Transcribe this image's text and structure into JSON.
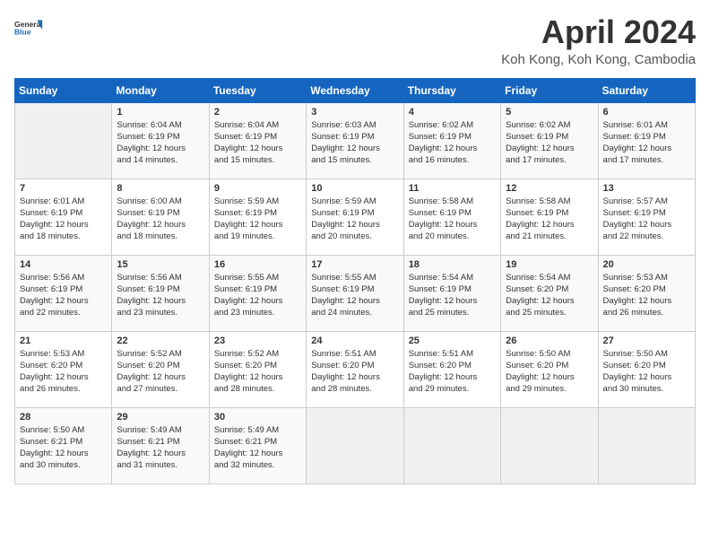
{
  "header": {
    "logo_line1": "General",
    "logo_line2": "Blue",
    "month": "April 2024",
    "location": "Koh Kong, Koh Kong, Cambodia"
  },
  "weekdays": [
    "Sunday",
    "Monday",
    "Tuesday",
    "Wednesday",
    "Thursday",
    "Friday",
    "Saturday"
  ],
  "weeks": [
    [
      {
        "day": "",
        "info": ""
      },
      {
        "day": "1",
        "info": "Sunrise: 6:04 AM\nSunset: 6:19 PM\nDaylight: 12 hours\nand 14 minutes."
      },
      {
        "day": "2",
        "info": "Sunrise: 6:04 AM\nSunset: 6:19 PM\nDaylight: 12 hours\nand 15 minutes."
      },
      {
        "day": "3",
        "info": "Sunrise: 6:03 AM\nSunset: 6:19 PM\nDaylight: 12 hours\nand 15 minutes."
      },
      {
        "day": "4",
        "info": "Sunrise: 6:02 AM\nSunset: 6:19 PM\nDaylight: 12 hours\nand 16 minutes."
      },
      {
        "day": "5",
        "info": "Sunrise: 6:02 AM\nSunset: 6:19 PM\nDaylight: 12 hours\nand 17 minutes."
      },
      {
        "day": "6",
        "info": "Sunrise: 6:01 AM\nSunset: 6:19 PM\nDaylight: 12 hours\nand 17 minutes."
      }
    ],
    [
      {
        "day": "7",
        "info": "Sunrise: 6:01 AM\nSunset: 6:19 PM\nDaylight: 12 hours\nand 18 minutes."
      },
      {
        "day": "8",
        "info": "Sunrise: 6:00 AM\nSunset: 6:19 PM\nDaylight: 12 hours\nand 18 minutes."
      },
      {
        "day": "9",
        "info": "Sunrise: 5:59 AM\nSunset: 6:19 PM\nDaylight: 12 hours\nand 19 minutes."
      },
      {
        "day": "10",
        "info": "Sunrise: 5:59 AM\nSunset: 6:19 PM\nDaylight: 12 hours\nand 20 minutes."
      },
      {
        "day": "11",
        "info": "Sunrise: 5:58 AM\nSunset: 6:19 PM\nDaylight: 12 hours\nand 20 minutes."
      },
      {
        "day": "12",
        "info": "Sunrise: 5:58 AM\nSunset: 6:19 PM\nDaylight: 12 hours\nand 21 minutes."
      },
      {
        "day": "13",
        "info": "Sunrise: 5:57 AM\nSunset: 6:19 PM\nDaylight: 12 hours\nand 22 minutes."
      }
    ],
    [
      {
        "day": "14",
        "info": "Sunrise: 5:56 AM\nSunset: 6:19 PM\nDaylight: 12 hours\nand 22 minutes."
      },
      {
        "day": "15",
        "info": "Sunrise: 5:56 AM\nSunset: 6:19 PM\nDaylight: 12 hours\nand 23 minutes."
      },
      {
        "day": "16",
        "info": "Sunrise: 5:55 AM\nSunset: 6:19 PM\nDaylight: 12 hours\nand 23 minutes."
      },
      {
        "day": "17",
        "info": "Sunrise: 5:55 AM\nSunset: 6:19 PM\nDaylight: 12 hours\nand 24 minutes."
      },
      {
        "day": "18",
        "info": "Sunrise: 5:54 AM\nSunset: 6:19 PM\nDaylight: 12 hours\nand 25 minutes."
      },
      {
        "day": "19",
        "info": "Sunrise: 5:54 AM\nSunset: 6:20 PM\nDaylight: 12 hours\nand 25 minutes."
      },
      {
        "day": "20",
        "info": "Sunrise: 5:53 AM\nSunset: 6:20 PM\nDaylight: 12 hours\nand 26 minutes."
      }
    ],
    [
      {
        "day": "21",
        "info": "Sunrise: 5:53 AM\nSunset: 6:20 PM\nDaylight: 12 hours\nand 26 minutes."
      },
      {
        "day": "22",
        "info": "Sunrise: 5:52 AM\nSunset: 6:20 PM\nDaylight: 12 hours\nand 27 minutes."
      },
      {
        "day": "23",
        "info": "Sunrise: 5:52 AM\nSunset: 6:20 PM\nDaylight: 12 hours\nand 28 minutes."
      },
      {
        "day": "24",
        "info": "Sunrise: 5:51 AM\nSunset: 6:20 PM\nDaylight: 12 hours\nand 28 minutes."
      },
      {
        "day": "25",
        "info": "Sunrise: 5:51 AM\nSunset: 6:20 PM\nDaylight: 12 hours\nand 29 minutes."
      },
      {
        "day": "26",
        "info": "Sunrise: 5:50 AM\nSunset: 6:20 PM\nDaylight: 12 hours\nand 29 minutes."
      },
      {
        "day": "27",
        "info": "Sunrise: 5:50 AM\nSunset: 6:20 PM\nDaylight: 12 hours\nand 30 minutes."
      }
    ],
    [
      {
        "day": "28",
        "info": "Sunrise: 5:50 AM\nSunset: 6:21 PM\nDaylight: 12 hours\nand 30 minutes."
      },
      {
        "day": "29",
        "info": "Sunrise: 5:49 AM\nSunset: 6:21 PM\nDaylight: 12 hours\nand 31 minutes."
      },
      {
        "day": "30",
        "info": "Sunrise: 5:49 AM\nSunset: 6:21 PM\nDaylight: 12 hours\nand 32 minutes."
      },
      {
        "day": "",
        "info": ""
      },
      {
        "day": "",
        "info": ""
      },
      {
        "day": "",
        "info": ""
      },
      {
        "day": "",
        "info": ""
      }
    ]
  ]
}
